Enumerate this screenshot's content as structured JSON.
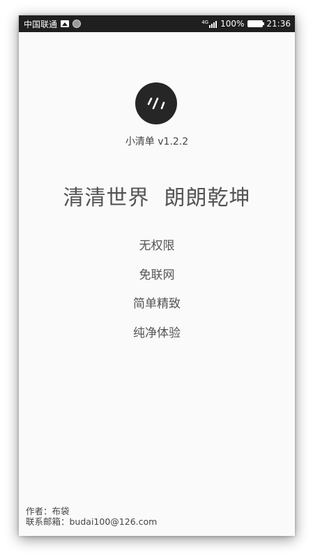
{
  "status_bar": {
    "carrier": "中国联通",
    "network": "4G",
    "battery": "100%",
    "time": "21:36"
  },
  "app": {
    "icon": "app-logo-icon",
    "name_version": "小清单 v1.2.2"
  },
  "slogan": "清清世界  朗朗乾坤",
  "features": [
    "无权限",
    "免联网",
    "简单精致",
    "纯净体验"
  ],
  "footer": {
    "author": "作者：布袋",
    "contact": "联系邮箱：budai100@126.com"
  }
}
